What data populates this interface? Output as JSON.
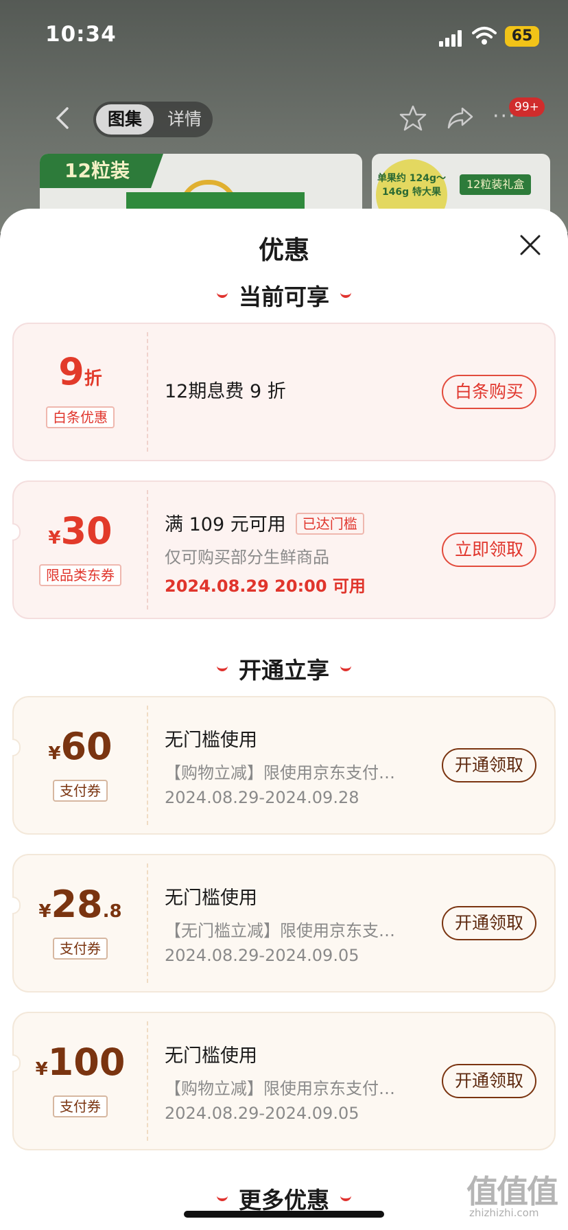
{
  "status": {
    "time": "10:34",
    "battery": "65"
  },
  "nav": {
    "seg_gallery": "图集",
    "seg_detail": "详情",
    "badge": "99+"
  },
  "thumbs": {
    "tag1": "12粒装",
    "seal": "单果约 124g～146g 特大果",
    "tag2": "12粒装礼盒"
  },
  "sheet": {
    "title": "优惠"
  },
  "sections": {
    "current": "当前可享",
    "open": "开通立享",
    "more": "更多优惠"
  },
  "cards": [
    {
      "amount_big": "9",
      "amount_unit": "折",
      "tag": "白条优惠",
      "main": "12期息费 9 折",
      "button": "白条购买"
    },
    {
      "currency": "¥",
      "amount_big": "30",
      "tag": "限品类东券",
      "main": "满 109 元可用",
      "met": "已达门槛",
      "sub": "仅可购买部分生鲜商品",
      "date": "2024.08.29 20:00 可用",
      "button": "立即领取"
    },
    {
      "currency": "¥",
      "amount_big": "60",
      "tag": "支付券",
      "main": "无门槛使用",
      "sub": "【购物立减】限使用京东支付…",
      "date": "2024.08.29-2024.09.28",
      "button": "开通领取"
    },
    {
      "currency": "¥",
      "amount_big": "28",
      "amount_dec": ".8",
      "tag": "支付券",
      "main": "无门槛使用",
      "sub": "【无门槛立减】限使用京东支…",
      "date": "2024.08.29-2024.09.05",
      "button": "开通领取"
    },
    {
      "currency": "¥",
      "amount_big": "100",
      "tag": "支付券",
      "main": "无门槛使用",
      "sub": "【购物立减】限使用京东支付…",
      "date": "2024.08.29-2024.09.05",
      "button": "开通领取"
    }
  ],
  "watermark": {
    "logo": "值值值",
    "url": "zhizhizhi.com"
  },
  "colors": {
    "accent_red": "#e0352c",
    "brown": "#7a3410"
  }
}
